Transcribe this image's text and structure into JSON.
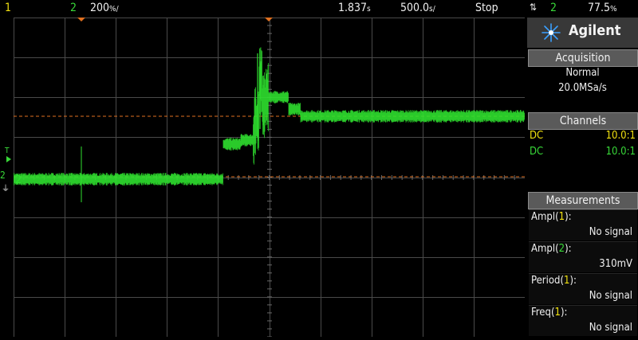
{
  "topbar": {
    "ch1_num": "1",
    "ch2_num": "2",
    "ch2_scale": "200",
    "ch2_scale_unit": "%/",
    "time_delay": "1.837",
    "time_delay_unit": "s",
    "time_scale": "500.0",
    "time_scale_unit": "s/",
    "run_state": "Stop",
    "trigger_source": "2",
    "trigger_level": "77.5",
    "trigger_level_unit": "%"
  },
  "screen": {
    "ch2_marker": "2",
    "trigger_marker": "T",
    "trace_color": "#2fe02f",
    "cursor_color": "#e07020",
    "grid_color": "#4a4a4a"
  },
  "panel": {
    "brand": "Agilent",
    "acquisition": {
      "title": "Acquisition",
      "mode": "Normal",
      "rate": "20.0MSa/s"
    },
    "channels": {
      "title": "Channels",
      "rows": [
        {
          "coupling": "DC",
          "probe": "10.0:1"
        },
        {
          "coupling": "DC",
          "probe": "10.0:1"
        }
      ]
    },
    "measurements": {
      "title": "Measurements",
      "items": [
        {
          "label": "Ampl",
          "ch": "1",
          "value": "No signal"
        },
        {
          "label": "Ampl",
          "ch": "2",
          "value": "310mV"
        },
        {
          "label": "Period",
          "ch": "1",
          "value": "No signal"
        },
        {
          "label": "Freq",
          "ch": "1",
          "value": "No signal"
        }
      ]
    }
  }
}
